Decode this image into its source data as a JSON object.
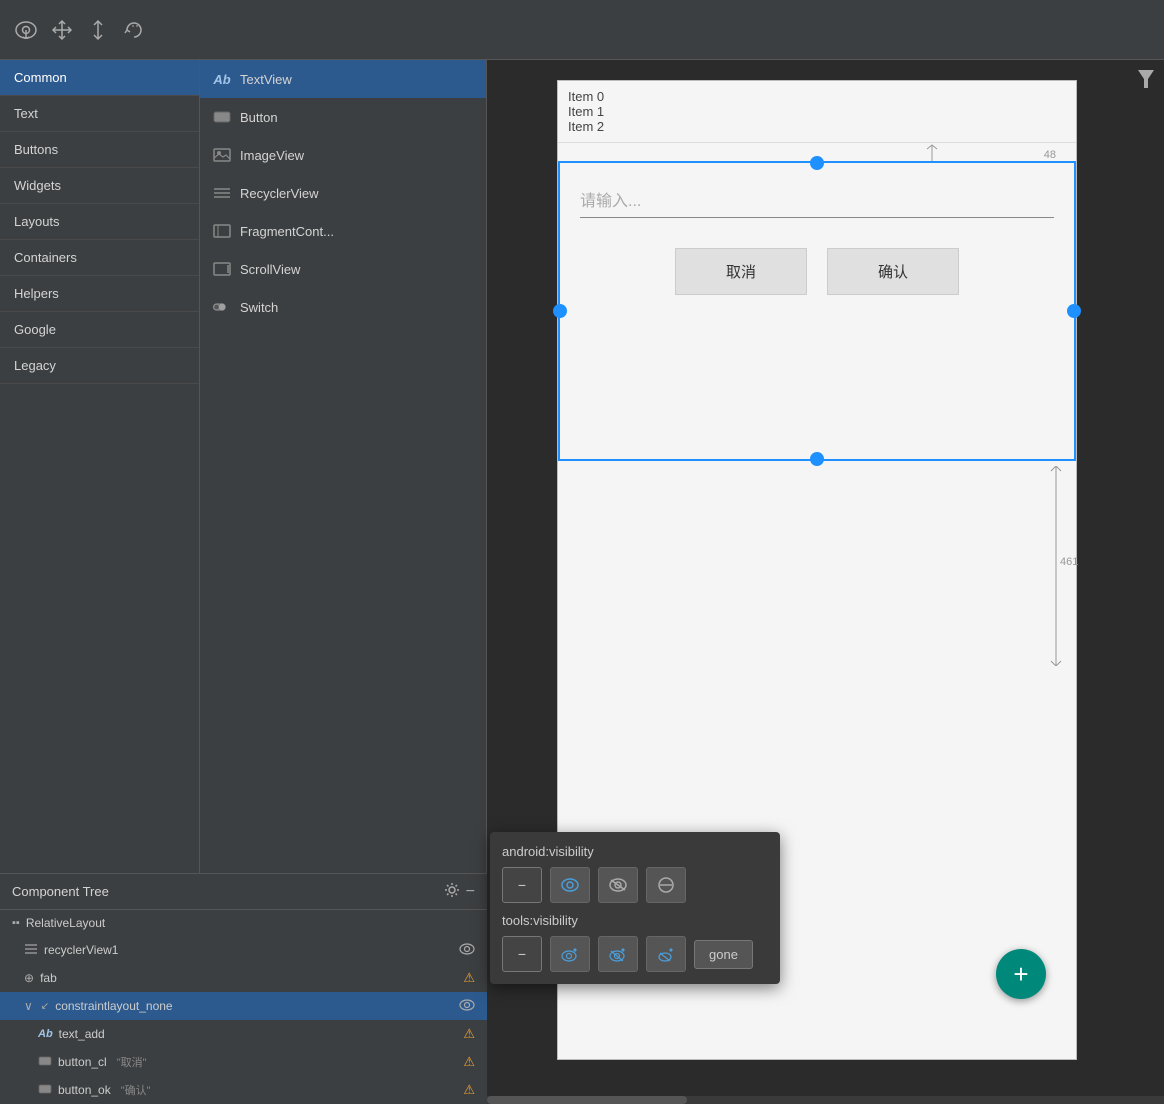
{
  "toolbar": {
    "icons": [
      "👁",
      "✛",
      "↕",
      "⟳"
    ]
  },
  "palette": {
    "categories": [
      {
        "id": "common",
        "label": "Common",
        "active": true
      },
      {
        "id": "text",
        "label": "Text",
        "active": false
      },
      {
        "id": "buttons",
        "label": "Buttons",
        "active": false
      },
      {
        "id": "widgets",
        "label": "Widgets",
        "active": false
      },
      {
        "id": "layouts",
        "label": "Layouts",
        "active": false
      },
      {
        "id": "containers",
        "label": "Containers",
        "active": false
      },
      {
        "id": "helpers",
        "label": "Helpers",
        "active": false
      },
      {
        "id": "google",
        "label": "Google",
        "active": false
      },
      {
        "id": "legacy",
        "label": "Legacy",
        "active": false
      }
    ]
  },
  "components": [
    {
      "id": "textview",
      "label": "TextView",
      "icon": "Ab",
      "active": true
    },
    {
      "id": "button",
      "label": "Button",
      "icon": "▬",
      "active": false
    },
    {
      "id": "imageview",
      "label": "ImageView",
      "icon": "🖼",
      "active": false
    },
    {
      "id": "recyclerview",
      "label": "RecyclerView",
      "icon": "≡",
      "active": false
    },
    {
      "id": "fragmentcont",
      "label": "FragmentCont...",
      "icon": "▭",
      "active": false
    },
    {
      "id": "scrollview",
      "label": "ScrollView",
      "icon": "▭",
      "active": false
    },
    {
      "id": "switch",
      "label": "Switch",
      "icon": "⬤",
      "active": false
    }
  ],
  "canvas": {
    "list_items": [
      "Item 0",
      "Item 1",
      "Item 2"
    ],
    "input_placeholder": "请输入...",
    "btn_cancel": "取消",
    "btn_confirm": "确认",
    "dimension_48": "48",
    "dimension_461": "461",
    "fab_icon": "+"
  },
  "component_tree": {
    "title": "Component Tree",
    "items": [
      {
        "id": "relative_layout",
        "label": "RelativeLayout",
        "indent": 0,
        "icon": "▪▪",
        "has_eye": false,
        "has_warning": false,
        "selected": false
      },
      {
        "id": "recyclerview1",
        "label": "recyclerView1",
        "indent": 1,
        "icon": "≡",
        "has_eye": true,
        "has_warning": false,
        "selected": false
      },
      {
        "id": "fab",
        "label": "fab",
        "indent": 1,
        "icon": "⊕",
        "has_eye": false,
        "has_warning": true,
        "selected": false
      },
      {
        "id": "constraintlayout_none",
        "label": "constraintlayout_none",
        "indent": 1,
        "icon": "↙",
        "has_eye": true,
        "has_warning": false,
        "selected": true
      },
      {
        "id": "text_add",
        "label": "text_add",
        "indent": 2,
        "icon": "Ab",
        "has_eye": false,
        "has_warning": true,
        "selected": false
      },
      {
        "id": "button_cl",
        "label": "button_cl",
        "indent": 2,
        "icon": "▬",
        "has_eye": false,
        "has_warning": true,
        "secondary": "\"取消\"",
        "selected": false
      },
      {
        "id": "button_ok",
        "label": "button_ok",
        "indent": 2,
        "icon": "▬",
        "has_eye": false,
        "has_warning": true,
        "secondary": "\"确认\"",
        "selected": false
      }
    ]
  },
  "visibility_popup": {
    "android_visibility_label": "android:visibility",
    "tools_visibility_label": "tools:visibility",
    "gone_label": "gone",
    "buttons_row1": [
      "—",
      "👁",
      "🚫👁",
      "⊘"
    ],
    "buttons_row2": [
      "—",
      "🔧",
      "🔧",
      "🔧"
    ]
  }
}
